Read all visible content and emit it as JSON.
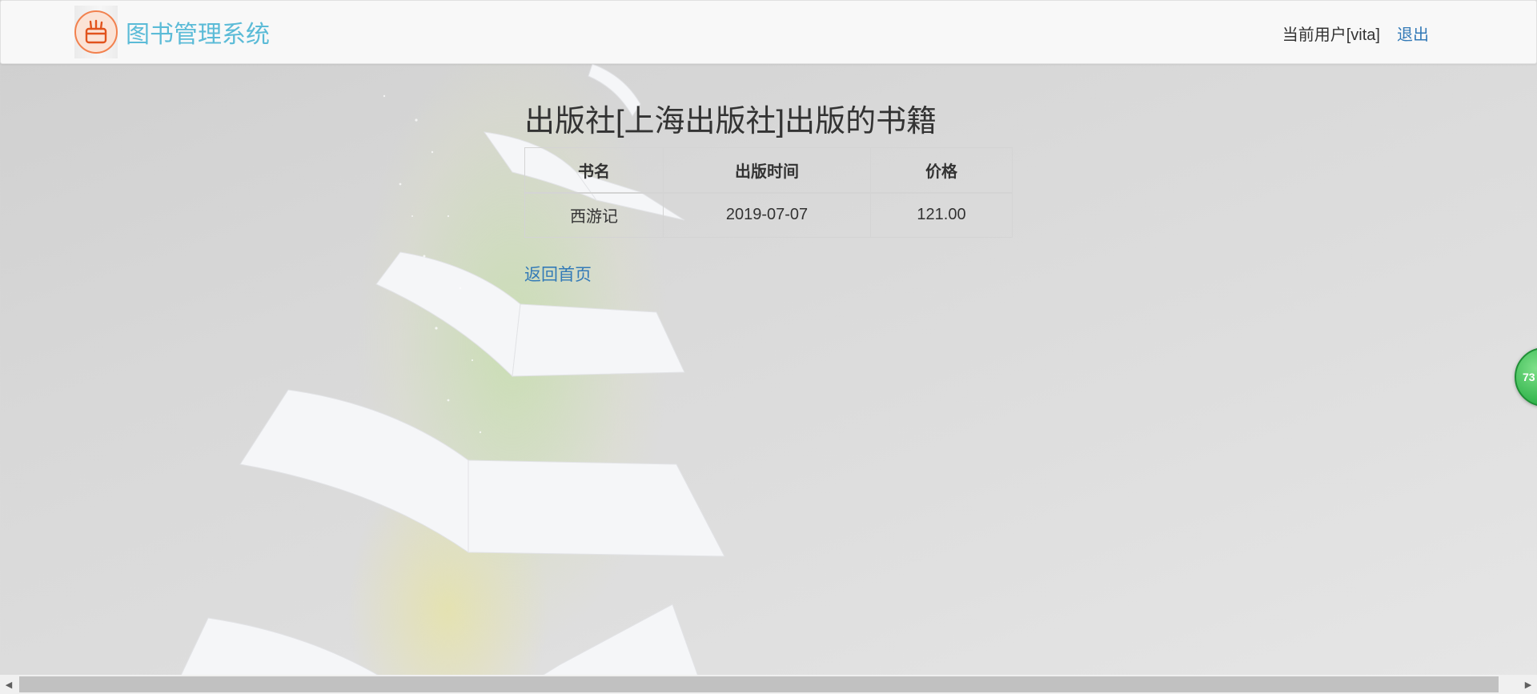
{
  "header": {
    "app_title": "图书管理系统",
    "logo_icon": "pencil-holder-icon",
    "current_user_label": "当前用户[vita]",
    "logout_label": "退出"
  },
  "main": {
    "title": "出版社[上海出版社]出版的书籍",
    "table": {
      "columns": [
        "书名",
        "出版时间",
        "价格"
      ],
      "rows": [
        [
          "西游记",
          "2019-07-07",
          "121.00"
        ]
      ]
    },
    "back_link": "返回首页"
  },
  "floating_badge": {
    "text": "73"
  },
  "colors": {
    "brand_title": "#5bbbd7",
    "link": "#337ab7",
    "logo_accent": "#f2814e",
    "badge": "#2fb34a"
  }
}
